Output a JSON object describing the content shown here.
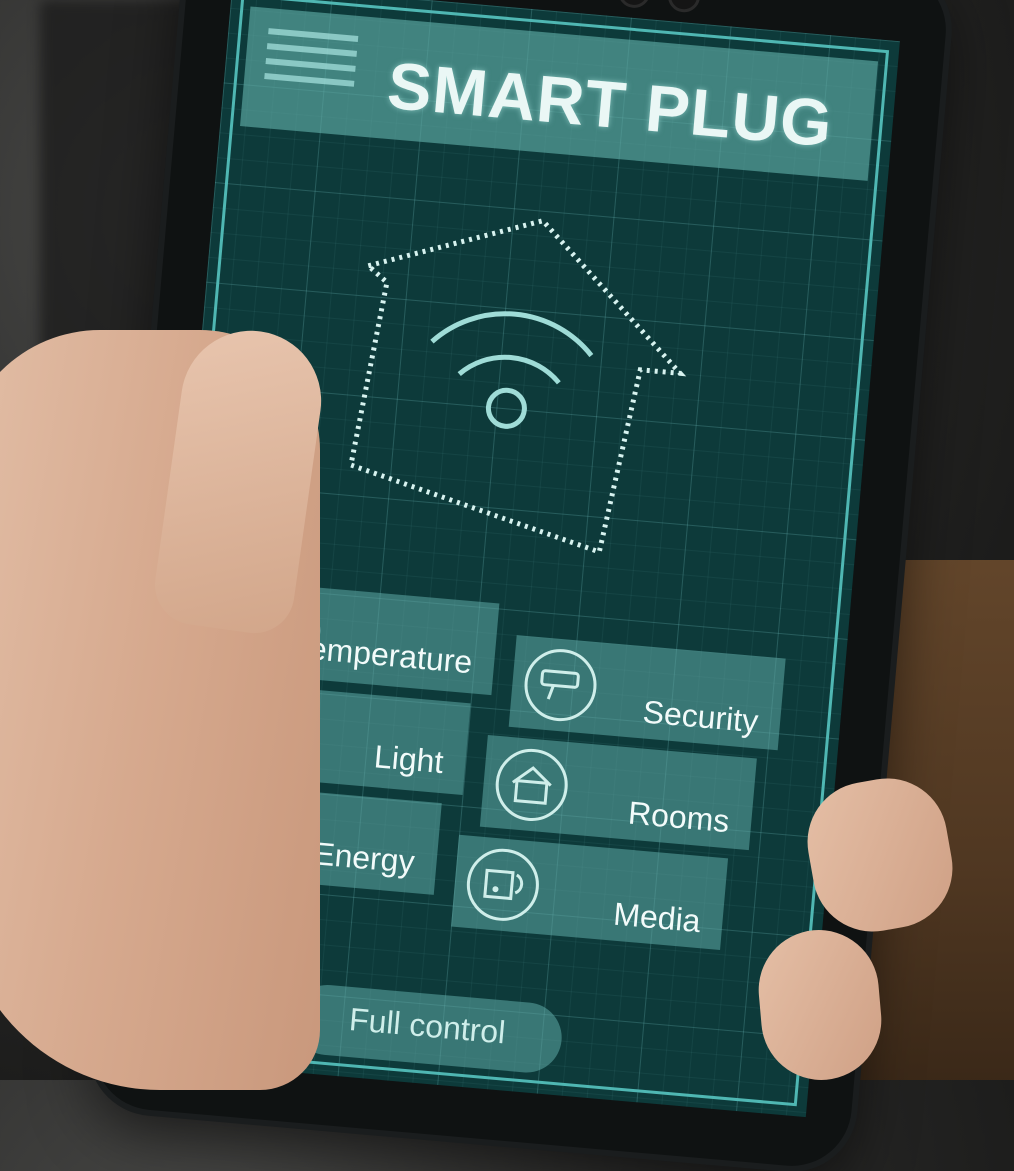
{
  "app": {
    "title": "SMART PLUG"
  },
  "header": {
    "menu_icon": "hamburger-menu-icon"
  },
  "center_graphic": {
    "icon": "house-wifi-icon"
  },
  "tiles": [
    {
      "label": "Temperature",
      "icon": "thermometer-icon"
    },
    {
      "label": "Security",
      "icon": "security-camera-icon"
    },
    {
      "label": "Light",
      "icon": "light-bulb-icon"
    },
    {
      "label": "Rooms",
      "icon": "house-rooms-icon"
    },
    {
      "label": "Energy",
      "icon": "power-plug-icon"
    },
    {
      "label": "Media",
      "icon": "media-music-icon"
    }
  ],
  "footer": {
    "full_control_label": "Full control"
  },
  "colors": {
    "screen_bg": "#0d3a3a",
    "accent": "#4fb7b3",
    "tile_bg": "#5eaaa5",
    "text": "#eaf7f5"
  }
}
